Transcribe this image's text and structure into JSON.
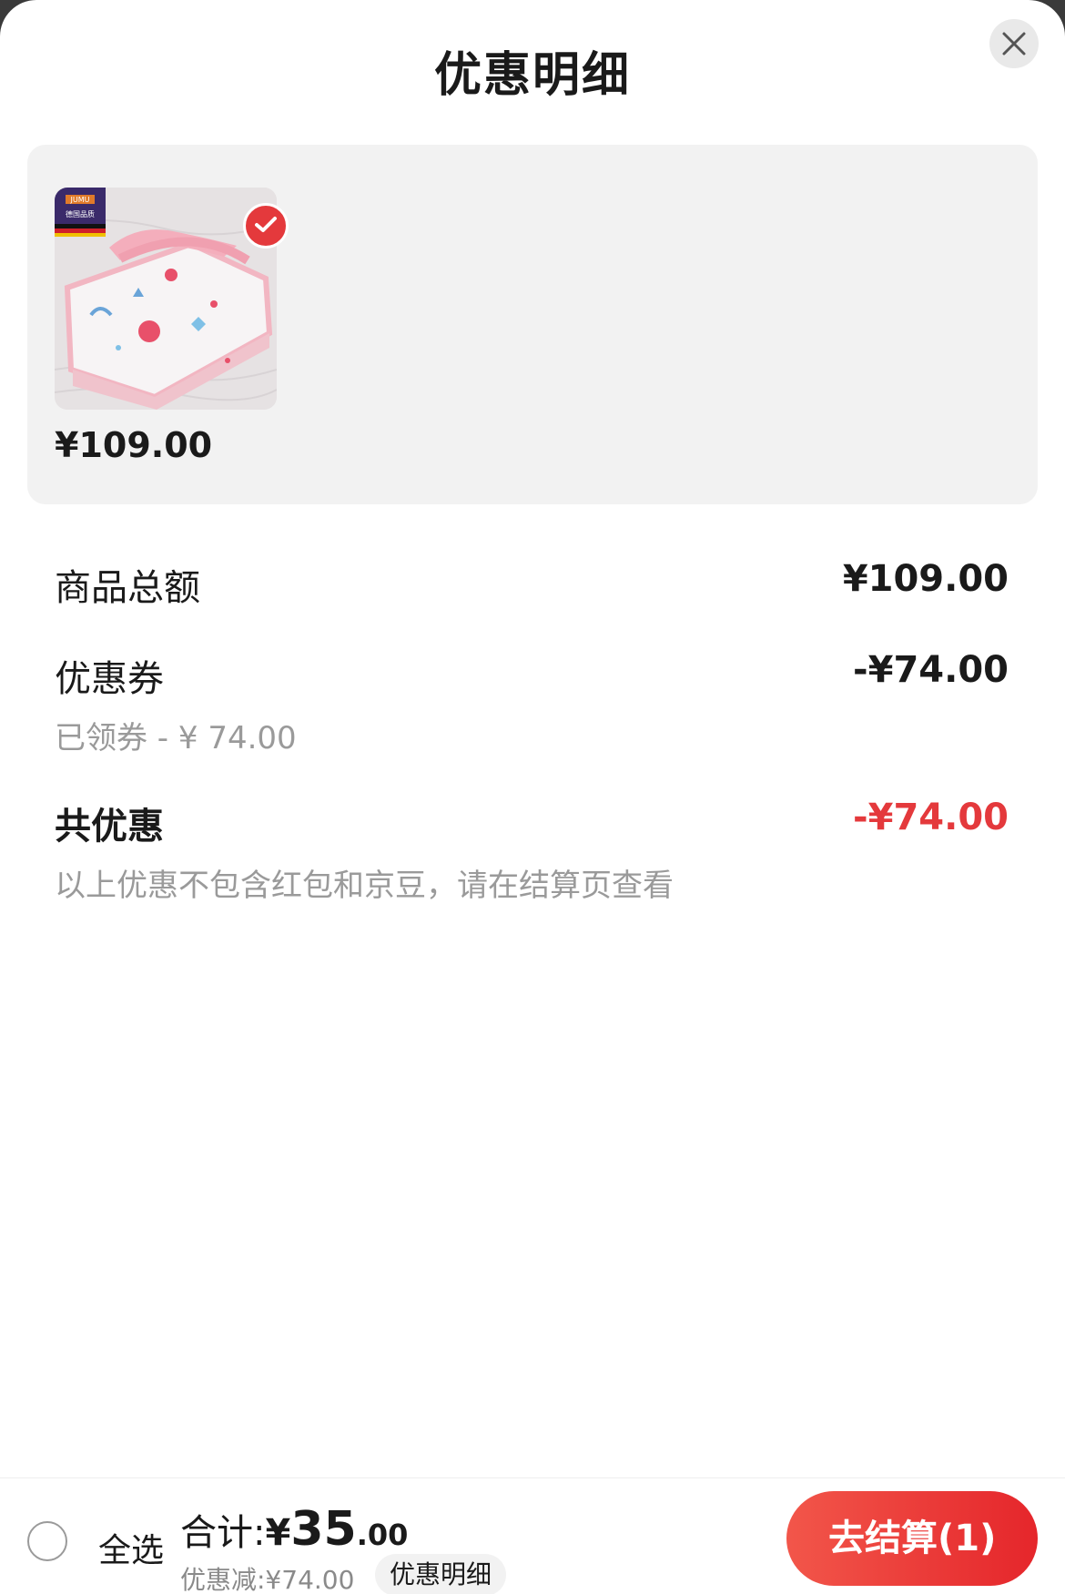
{
  "header": {
    "title": "优惠明细"
  },
  "product": {
    "price": "¥109.00",
    "badge_top": "JUMU",
    "badge_text": "德国品质"
  },
  "summary": {
    "goods_total_label": "商品总额",
    "goods_total_value": "¥109.00",
    "coupon_label": "优惠券",
    "coupon_value": "-¥74.00",
    "coupon_sub": "已领券 - ¥ 74.00",
    "total_discount_label": "共优惠",
    "total_discount_value": "-¥74.00",
    "note": "以上优惠不包含红包和京豆，请在结算页查看"
  },
  "footer": {
    "select_all_label": "全选",
    "total_label": "合计:",
    "total_symbol": "¥",
    "total_int": "35",
    "total_dec": ".00",
    "discount_text": "优惠减:¥74.00",
    "detail_chip_label": "优惠明细",
    "checkout_label": "去结算(1)"
  },
  "colors": {
    "accent_red": "#e4393c",
    "card_bg": "#f2f2f2",
    "muted_text": "#9a9a9a"
  },
  "icons": {
    "close": "close-icon",
    "check": "check-icon",
    "select_all": "radio-circle-icon"
  }
}
